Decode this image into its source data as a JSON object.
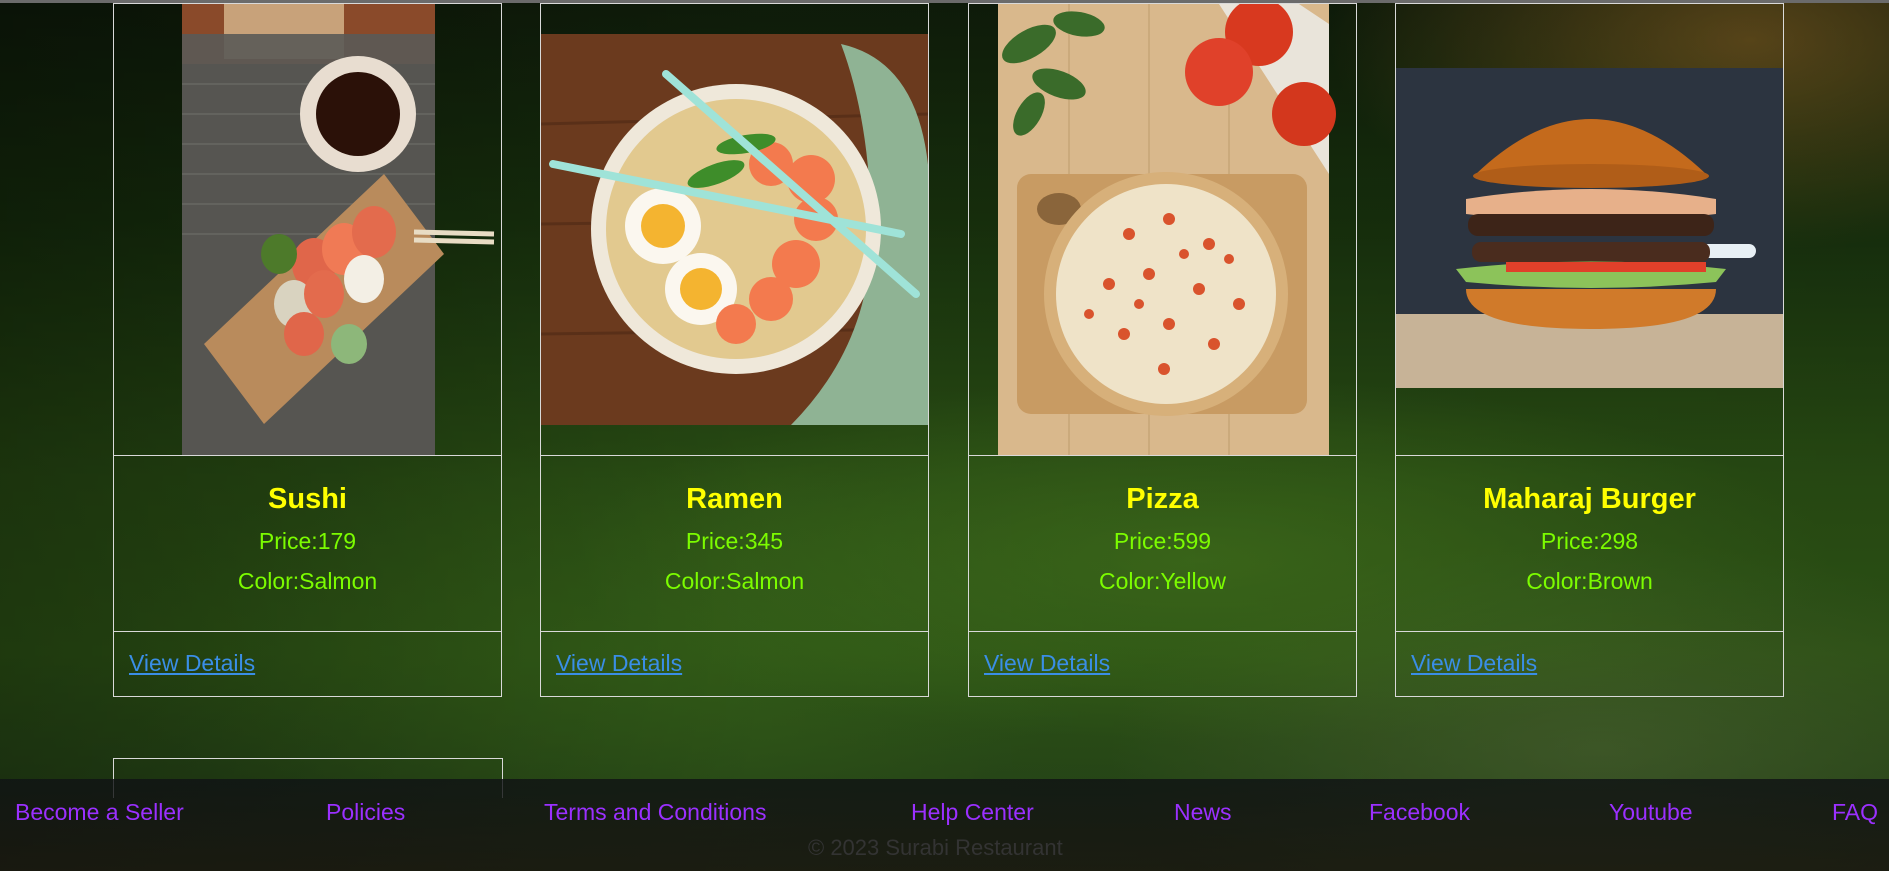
{
  "products": [
    {
      "name": "Sushi",
      "price": "Price:179",
      "color": "Color:Salmon",
      "link": "View Details",
      "image_icon": "sushi-plate"
    },
    {
      "name": "Ramen",
      "price": "Price:345",
      "color": "Color:Salmon",
      "link": "View Details",
      "image_icon": "ramen-bowl"
    },
    {
      "name": "Pizza",
      "price": "Price:599",
      "color": "Color:Yellow",
      "link": "View Details",
      "image_icon": "pizza-board"
    },
    {
      "name": "Maharaj Burger",
      "price": "Price:298",
      "color": "Color:Brown",
      "link": "View Details",
      "image_icon": "burger"
    }
  ],
  "footer": {
    "links": [
      "Become a Seller",
      "Policies",
      "Terms and Conditions",
      "Help Center",
      "News",
      "Facebook",
      "Youtube",
      "FAQ"
    ],
    "copyright": "© 2023 Surabi Restaurant"
  },
  "colors": {
    "title": "#ffff00",
    "details": "#7cfc00",
    "link": "#3a8ee6",
    "footer_link": "#9b30ff"
  }
}
